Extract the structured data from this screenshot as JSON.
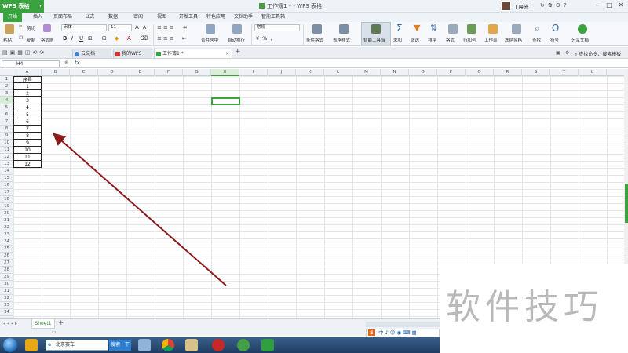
{
  "titlebar": {
    "app_button_label": "WPS 表格",
    "document_title": "工作簿1 * - WPS 表格",
    "user_name": "丁晨光",
    "window_controls": {
      "minimize": "–",
      "maximize": "□",
      "close": "✕"
    }
  },
  "menu": {
    "tabs": [
      {
        "label": "开始",
        "active": true
      },
      {
        "label": "插入"
      },
      {
        "label": "页面布局"
      },
      {
        "label": "公式"
      },
      {
        "label": "数据"
      },
      {
        "label": "审阅"
      },
      {
        "label": "视图"
      },
      {
        "label": "开发工具"
      },
      {
        "label": "特色应用"
      },
      {
        "label": "文档助手"
      },
      {
        "label": "智能工具箱"
      }
    ]
  },
  "ribbon": {
    "paste": "粘贴",
    "cut": "剪切",
    "copy": "复制",
    "format_painter": "格式刷",
    "font_name": "宋体",
    "font_size": "11",
    "merge_center": "合并居中",
    "wrap_text": "自动换行",
    "number_format": "常规",
    "conditional_format": "条件格式",
    "table_style": "表格样式",
    "smart_toolbox": "智能工具箱",
    "sum": "求和",
    "filter": "筛选",
    "sort": "排序",
    "format": "格式",
    "rows_cols": "行和列",
    "worksheet": "工作表",
    "freeze": "冻结窗格",
    "find": "查找",
    "symbol": "符号",
    "share": "分享文档"
  },
  "docbar": {
    "tabs": [
      {
        "label": "云文档"
      },
      {
        "label": "我的WPS"
      },
      {
        "label": "工作簿1 *",
        "active": true
      }
    ],
    "new_tab": "+",
    "search_placeholder": "查找命令、搜索模板"
  },
  "formula_bar": {
    "name_box": "H4",
    "fx_label": "fx",
    "content": ""
  },
  "grid": {
    "columns": [
      "A",
      "B",
      "C",
      "D",
      "E",
      "F",
      "G",
      "H",
      "I",
      "J",
      "K",
      "L",
      "M",
      "N",
      "O",
      "P",
      "Q",
      "R",
      "S",
      "T",
      "U"
    ],
    "selected_column": "H",
    "selected_row": 4,
    "row_count": 34,
    "cells_A": [
      "序号",
      "1",
      "2",
      "3",
      "4",
      "5",
      "6",
      "7",
      "8",
      "9",
      "10",
      "11",
      "12"
    ]
  },
  "sheets": {
    "tabs": [
      "Sheet1"
    ],
    "add": "+"
  },
  "taskbar": {
    "search_text": "北京赛车",
    "search_button": "搜索一下"
  },
  "ime": {
    "label": "中"
  },
  "watermark": {
    "text": "软件技巧"
  },
  "colors": {
    "accent": "#3aa33f",
    "arrow": "#8b1a1a"
  }
}
